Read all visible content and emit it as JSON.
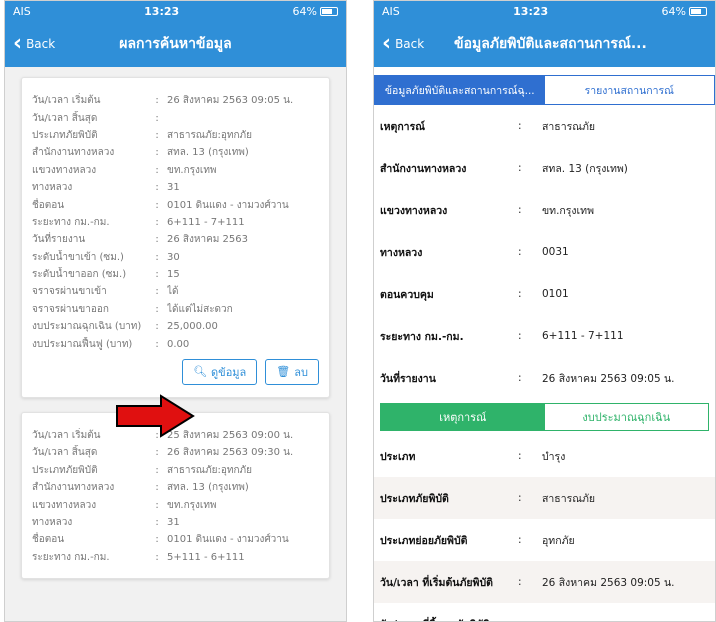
{
  "left": {
    "status": {
      "carrier": "AIS",
      "time": "13:23",
      "battery": "64%"
    },
    "nav": {
      "back": "Back",
      "title": "ผลการค้นหาข้อมูล"
    },
    "cards": [
      {
        "rows": [
          {
            "k": "วัน/เวลา เริ่มต้น",
            "v": "26 สิงหาคม 2563 09:05 น."
          },
          {
            "k": "วัน/เวลา สิ้นสุด",
            "v": ""
          },
          {
            "k": "ประเภทภัยพิบัติ",
            "v": "สาธารณภัย:อุทกภัย"
          },
          {
            "k": "สำนักงานทางหลวง",
            "v": "สทล. 13 (กรุงเทพ)"
          },
          {
            "k": "แขวงทางหลวง",
            "v": "ขท.กรุงเทพ"
          },
          {
            "k": "ทางหลวง",
            "v": "31"
          },
          {
            "k": "ชื่อตอน",
            "v": "0101 ดินแดง - งามวงศ์วาน"
          },
          {
            "k": "ระยะทาง กม.-กม.",
            "v": "6+111 - 7+111"
          },
          {
            "k": "วันที่รายงาน",
            "v": "26 สิงหาคม 2563"
          },
          {
            "k": "ระดับน้ำขาเข้า (ซม.)",
            "v": "30"
          },
          {
            "k": "ระดับน้ำขาออก (ซม.)",
            "v": "15"
          },
          {
            "k": "จราจรผ่านขาเข้า",
            "v": "ได้"
          },
          {
            "k": "จราจรผ่านขาออก",
            "v": "ได้แต่ไม่สะดวก"
          },
          {
            "k": "งบประมาณฉุกเฉิน (บาท)",
            "v": "25,000.00"
          },
          {
            "k": "งบประมาณฟื้นฟู (บาท)",
            "v": "0.00"
          }
        ],
        "view_label": "ดูข้อมูล",
        "delete_label": "ลบ"
      },
      {
        "rows": [
          {
            "k": "วัน/เวลา เริ่มต้น",
            "v": "25 สิงหาคม 2563 09:00 น."
          },
          {
            "k": "วัน/เวลา สิ้นสุด",
            "v": "26 สิงหาคม 2563 09:30 น."
          },
          {
            "k": "ประเภทภัยพิบัติ",
            "v": "สาธารณภัย:อุทกภัย"
          },
          {
            "k": "สำนักงานทางหลวง",
            "v": "สทล. 13 (กรุงเทพ)"
          },
          {
            "k": "แขวงทางหลวง",
            "v": "ขท.กรุงเทพ"
          },
          {
            "k": "ทางหลวง",
            "v": "31"
          },
          {
            "k": "ชื่อตอน",
            "v": "0101 ดินแดง - งามวงศ์วาน"
          },
          {
            "k": "ระยะทาง กม.-กม.",
            "v": "5+111 - 6+111"
          }
        ]
      }
    ],
    "colon": ":"
  },
  "right": {
    "status": {
      "carrier": "AIS",
      "time": "13:23",
      "battery": "64%"
    },
    "nav": {
      "back": "Back",
      "title": "ข้อมูลภัยพิบัติและสถานการณ์..."
    },
    "tabs": {
      "active": "ข้อมูลภัยพิบัติและสถานการณ์ฉุ...",
      "inactive": "รายงานสถานการณ์"
    },
    "rows": [
      {
        "k": "เหตุการณ์",
        "v": "สาธารณภัย"
      },
      {
        "k": "สำนักงานทางหลวง",
        "v": "สทล. 13 (กรุงเทพ)"
      },
      {
        "k": "แขวงทางหลวง",
        "v": "ขท.กรุงเทพ"
      },
      {
        "k": "ทางหลวง",
        "v": "0031"
      },
      {
        "k": "ตอนควบคุม",
        "v": "0101"
      },
      {
        "k": "ระยะทาง กม.-กม.",
        "v": "6+111 - 7+111"
      },
      {
        "k": "วันที่รายงาน",
        "v": "26 สิงหาคม 2563 09:05 น."
      }
    ],
    "tabs2": {
      "active": "เหตุการณ์",
      "inactive": "งบประมาณฉุกเฉิน"
    },
    "rows2": [
      {
        "k": "ประเภท",
        "v": "บำรุง"
      },
      {
        "k": "ประเภทภัยพิบัติ",
        "v": "สาธารณภัย"
      },
      {
        "k": "ประเภทย่อยภัยพิบัติ",
        "v": "อุทกภัย"
      },
      {
        "k": "วัน/เวลา ที่เริ่มต้นภัยพิบัติ",
        "v": "26 สิงหาคม 2563 09:05 น."
      },
      {
        "k": "วัน/เวลา ที่สิ้นสุดภัยพิบัติ",
        "v": ""
      }
    ],
    "colon": ":"
  },
  "colors": {
    "header": "#2f8fd8",
    "tab_blue": "#2f6fd0",
    "tab_green": "#2fb36a",
    "arrow": "#e01010"
  }
}
